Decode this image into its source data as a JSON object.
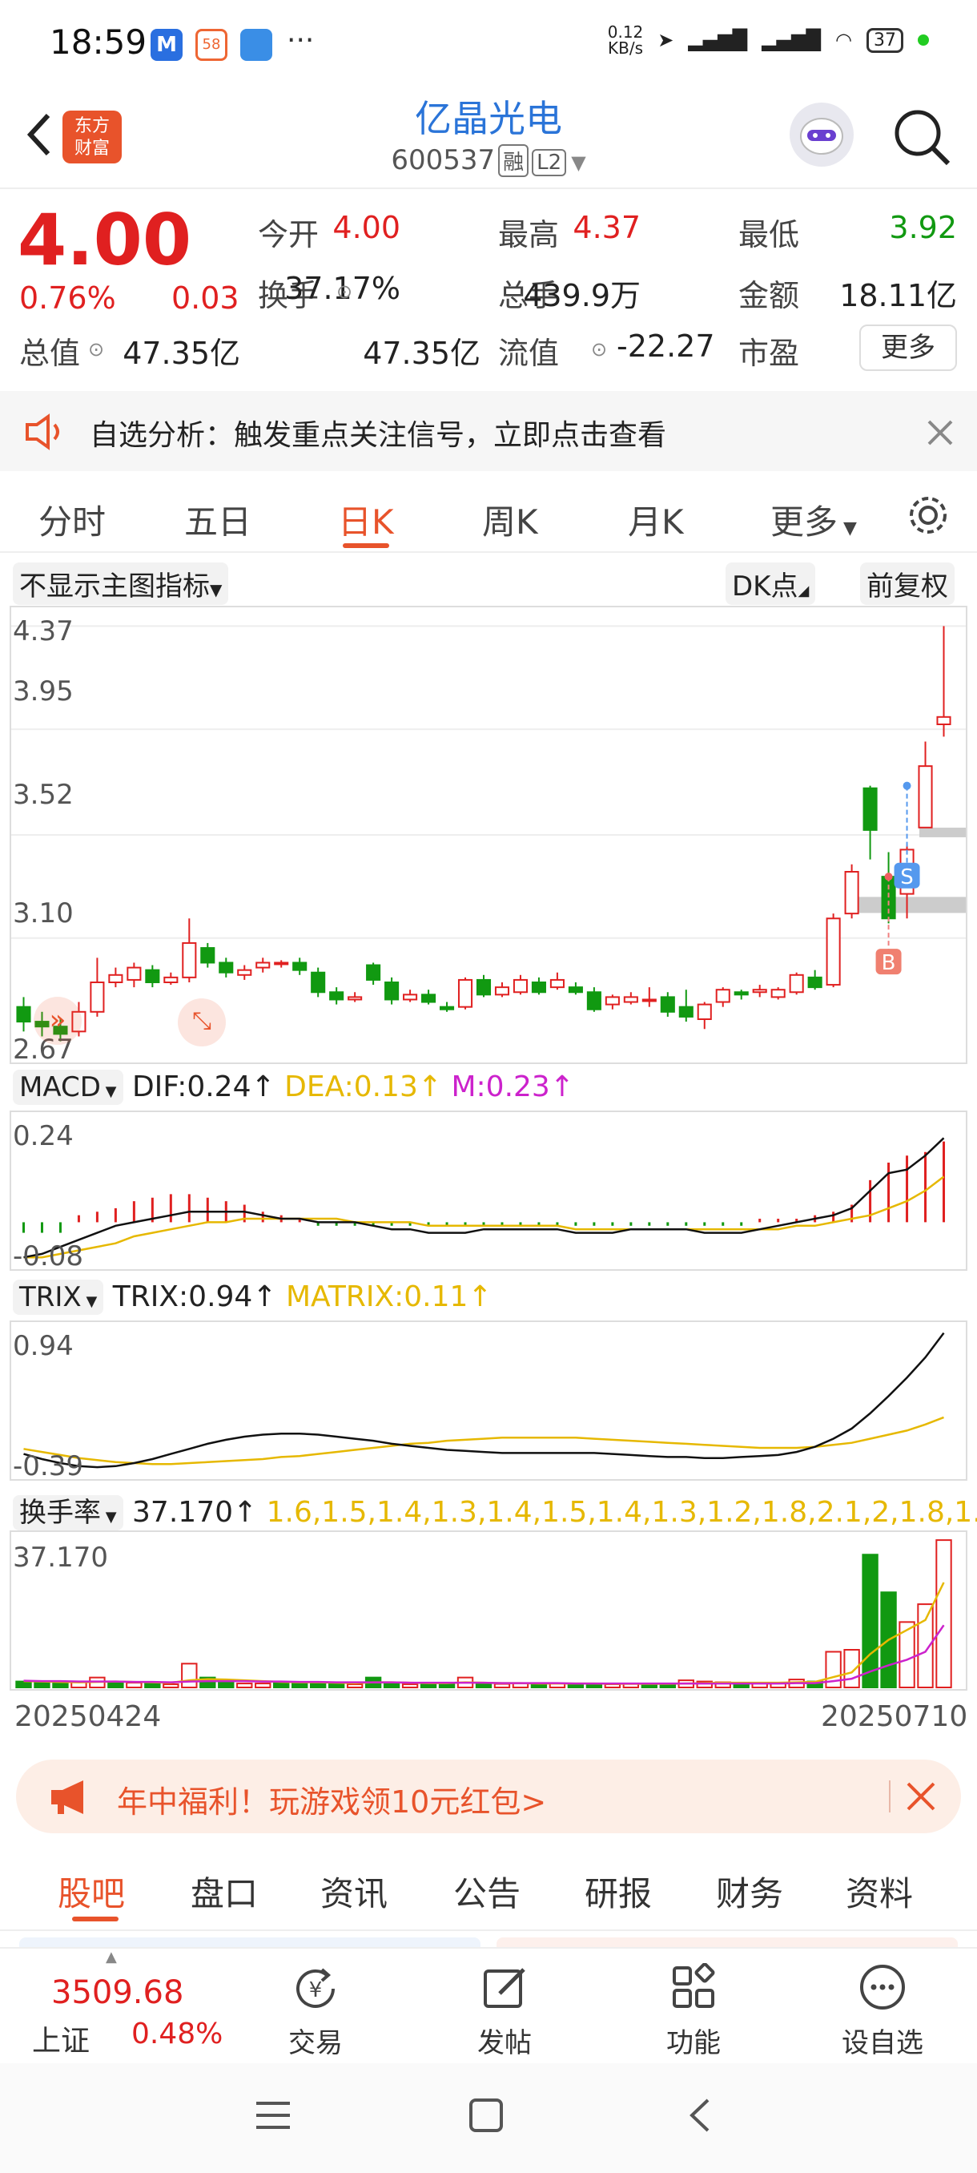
{
  "status_bar": {
    "time": "18:59",
    "net_speed": "0.12\nKB/s",
    "battery": "37"
  },
  "header": {
    "title": "亿晶光电",
    "code": "600537",
    "tag1": "融",
    "tag2": "L2",
    "logo": "东方\n财富"
  },
  "quote": {
    "price": "4.00",
    "change_pct": "0.76%",
    "change": "0.03",
    "fields": [
      {
        "label": "今开",
        "value": "4.00",
        "color": "red"
      },
      {
        "label": "最高",
        "value": "4.37",
        "color": "red"
      },
      {
        "label": "最低",
        "value": "3.92",
        "color": "green"
      },
      {
        "label": "换手",
        "value": "37.17%",
        "color": "black"
      },
      {
        "label": "总手",
        "value": "439.9万",
        "color": "black"
      },
      {
        "label": "金额",
        "value": "18.11亿",
        "color": "black"
      },
      {
        "label": "总值",
        "value": "47.35亿",
        "color": "black"
      },
      {
        "label": "流值",
        "value": "47.35亿",
        "color": "black"
      },
      {
        "label": "市盈",
        "value": "-22.27",
        "color": "black"
      }
    ],
    "more": "更多"
  },
  "notice": {
    "text": "自选分析：触发重点关注信号，立即点击查看"
  },
  "tabs": [
    "分时",
    "五日",
    "日K",
    "周K",
    "月K",
    "更多"
  ],
  "active_tab": "日K",
  "chart_toolbar": {
    "indicator": "不显示主图指标",
    "dk": "DK点",
    "adjust": "前复权"
  },
  "chart_data": [
    {
      "type": "candlestick",
      "y_ticks": [
        "4.37",
        "3.95",
        "3.52",
        "3.10",
        "2.67"
      ],
      "ylim": [
        2.62,
        4.42
      ],
      "markers": [
        "B",
        "S"
      ],
      "candles": [
        [
          2.82,
          2.76,
          2.86,
          2.72
        ],
        [
          2.76,
          2.74,
          2.8,
          2.7
        ],
        [
          2.74,
          2.71,
          2.77,
          2.68
        ],
        [
          2.72,
          2.8,
          2.84,
          2.7
        ],
        [
          2.8,
          2.92,
          3.02,
          2.78
        ],
        [
          2.92,
          2.95,
          2.98,
          2.9
        ],
        [
          2.93,
          2.98,
          3.0,
          2.9
        ],
        [
          2.97,
          2.92,
          2.99,
          2.9
        ],
        [
          2.92,
          2.94,
          2.96,
          2.91
        ],
        [
          2.94,
          3.08,
          3.18,
          2.92
        ],
        [
          3.06,
          3.0,
          3.08,
          2.98
        ],
        [
          3.0,
          2.96,
          3.02,
          2.94
        ],
        [
          2.95,
          2.97,
          2.99,
          2.93
        ],
        [
          2.98,
          3.0,
          3.02,
          2.96
        ],
        [
          3.0,
          3.0,
          3.01,
          2.98
        ],
        [
          3.0,
          2.97,
          3.02,
          2.95
        ],
        [
          2.96,
          2.88,
          2.98,
          2.86
        ],
        [
          2.88,
          2.85,
          2.9,
          2.83
        ],
        [
          2.85,
          2.86,
          2.88,
          2.84
        ],
        [
          2.99,
          2.93,
          3.0,
          2.91
        ],
        [
          2.92,
          2.85,
          2.94,
          2.83
        ],
        [
          2.85,
          2.87,
          2.89,
          2.84
        ],
        [
          2.87,
          2.84,
          2.89,
          2.83
        ],
        [
          2.82,
          2.81,
          2.84,
          2.8
        ],
        [
          2.82,
          2.93,
          2.94,
          2.81
        ],
        [
          2.93,
          2.87,
          2.95,
          2.86
        ],
        [
          2.87,
          2.9,
          2.92,
          2.86
        ],
        [
          2.88,
          2.93,
          2.95,
          2.87
        ],
        [
          2.92,
          2.88,
          2.94,
          2.87
        ],
        [
          2.9,
          2.93,
          2.96,
          2.89
        ],
        [
          2.9,
          2.88,
          2.92,
          2.87
        ],
        [
          2.88,
          2.81,
          2.9,
          2.8
        ],
        [
          2.83,
          2.86,
          2.87,
          2.81
        ],
        [
          2.84,
          2.86,
          2.88,
          2.83
        ],
        [
          2.85,
          2.85,
          2.9,
          2.82
        ],
        [
          2.86,
          2.8,
          2.88,
          2.78
        ],
        [
          2.82,
          2.78,
          2.89,
          2.76
        ],
        [
          2.77,
          2.83,
          2.84,
          2.73
        ],
        [
          2.84,
          2.89,
          2.9,
          2.82
        ],
        [
          2.88,
          2.87,
          2.89,
          2.85
        ],
        [
          2.88,
          2.89,
          2.91,
          2.86
        ],
        [
          2.86,
          2.89,
          2.9,
          2.85
        ],
        [
          2.88,
          2.95,
          2.96,
          2.87
        ],
        [
          2.94,
          2.9,
          2.97,
          2.89
        ],
        [
          2.91,
          3.18,
          3.2,
          2.9
        ],
        [
          3.2,
          3.37,
          3.4,
          3.18
        ],
        [
          3.71,
          3.54,
          3.72,
          3.42
        ],
        [
          3.35,
          3.18,
          3.45,
          3.16
        ],
        [
          3.28,
          3.46,
          3.48,
          3.18
        ],
        [
          3.55,
          3.8,
          3.9,
          3.55
        ],
        [
          3.97,
          4.0,
          4.37,
          3.92
        ]
      ]
    },
    {
      "type": "macd",
      "label": "MACD",
      "dif": "DIF:0.24",
      "dea": "DEA:0.13",
      "m": "M:0.23",
      "y_ticks": [
        "0.24",
        "-0.08"
      ],
      "ylim": [
        -0.12,
        0.3
      ],
      "dif_values": [
        -0.1,
        -0.09,
        -0.07,
        -0.05,
        -0.03,
        -0.01,
        0.0,
        0.01,
        0.02,
        0.03,
        0.03,
        0.03,
        0.03,
        0.02,
        0.01,
        0.01,
        0.0,
        0.0,
        0.0,
        -0.01,
        -0.02,
        -0.02,
        -0.03,
        -0.03,
        -0.03,
        -0.02,
        -0.02,
        -0.02,
        -0.02,
        -0.02,
        -0.03,
        -0.03,
        -0.03,
        -0.02,
        -0.02,
        -0.02,
        -0.02,
        -0.03,
        -0.03,
        -0.03,
        -0.02,
        -0.01,
        0.0,
        0.01,
        0.02,
        0.04,
        0.09,
        0.14,
        0.15,
        0.19,
        0.24
      ],
      "dea_values": [
        -0.1,
        -0.1,
        -0.09,
        -0.08,
        -0.07,
        -0.06,
        -0.04,
        -0.03,
        -0.02,
        -0.01,
        0.0,
        0.0,
        0.01,
        0.01,
        0.01,
        0.01,
        0.01,
        0.01,
        0.0,
        0.0,
        0.0,
        0.0,
        -0.01,
        -0.01,
        -0.01,
        -0.01,
        -0.01,
        -0.01,
        -0.01,
        -0.01,
        -0.02,
        -0.02,
        -0.02,
        -0.02,
        -0.02,
        -0.02,
        -0.02,
        -0.02,
        -0.02,
        -0.02,
        -0.02,
        -0.02,
        -0.01,
        -0.01,
        0.0,
        0.01,
        0.02,
        0.04,
        0.06,
        0.09,
        0.13
      ],
      "m_values": [
        -0.03,
        -0.03,
        -0.03,
        0.02,
        0.03,
        0.04,
        0.06,
        0.07,
        0.08,
        0.08,
        0.07,
        0.06,
        0.05,
        0.03,
        0.02,
        0.01,
        -0.01,
        -0.01,
        -0.01,
        -0.01,
        -0.01,
        -0.01,
        -0.01,
        -0.01,
        -0.01,
        -0.01,
        -0.01,
        -0.01,
        -0.01,
        -0.01,
        -0.01,
        -0.01,
        -0.01,
        -0.01,
        -0.01,
        -0.01,
        -0.01,
        -0.01,
        -0.01,
        -0.01,
        0.01,
        0.01,
        0.01,
        0.02,
        0.03,
        0.05,
        0.12,
        0.17,
        0.19,
        0.2,
        0.23
      ]
    },
    {
      "type": "line",
      "label": "TRIX",
      "trix": "TRIX:0.94",
      "matrix": "MATRIX:0.11",
      "y_ticks": [
        "0.94",
        "-0.39"
      ],
      "ylim": [
        -0.45,
        1.0
      ],
      "trix_values": [
        -0.25,
        -0.3,
        -0.34,
        -0.37,
        -0.38,
        -0.37,
        -0.34,
        -0.3,
        -0.25,
        -0.2,
        -0.15,
        -0.11,
        -0.08,
        -0.06,
        -0.05,
        -0.05,
        -0.06,
        -0.08,
        -0.1,
        -0.12,
        -0.15,
        -0.17,
        -0.19,
        -0.21,
        -0.22,
        -0.23,
        -0.24,
        -0.24,
        -0.24,
        -0.24,
        -0.24,
        -0.24,
        -0.25,
        -0.26,
        -0.27,
        -0.28,
        -0.28,
        -0.29,
        -0.29,
        -0.28,
        -0.27,
        -0.26,
        -0.23,
        -0.18,
        -0.1,
        0.0,
        0.15,
        0.32,
        0.5,
        0.7,
        0.94
      ],
      "matrix_values": [
        -0.2,
        -0.23,
        -0.26,
        -0.29,
        -0.31,
        -0.33,
        -0.34,
        -0.35,
        -0.35,
        -0.34,
        -0.33,
        -0.32,
        -0.31,
        -0.3,
        -0.28,
        -0.27,
        -0.25,
        -0.23,
        -0.21,
        -0.19,
        -0.17,
        -0.15,
        -0.14,
        -0.12,
        -0.11,
        -0.1,
        -0.09,
        -0.09,
        -0.09,
        -0.09,
        -0.09,
        -0.1,
        -0.11,
        -0.12,
        -0.13,
        -0.14,
        -0.15,
        -0.16,
        -0.17,
        -0.18,
        -0.19,
        -0.19,
        -0.19,
        -0.18,
        -0.16,
        -0.14,
        -0.1,
        -0.06,
        -0.02,
        0.04,
        0.11
      ]
    },
    {
      "type": "bar",
      "label": "换手率",
      "value": "37.170",
      "ma1": [
        1.6,
        1.5,
        1.4,
        1.3,
        1.4,
        1.5,
        1.4,
        1.3,
        1.2,
        1.8,
        2.1,
        2.0,
        1.8,
        1.6,
        1.4,
        1.3,
        1.3,
        1.2,
        1.1,
        1.3,
        1.3,
        1.2,
        1.1,
        1.1,
        1.3,
        1.2,
        1.1,
        1.1,
        1.0,
        1.0,
        1.0,
        1.0,
        0.9,
        0.9,
        0.9,
        0.9,
        1.0,
        1.1,
        1.2,
        1.2,
        1.2,
        1.2,
        1.3,
        1.4,
        2.6,
        3.8,
        8.4,
        12.0,
        14.5,
        17.0,
        26.48
      ],
      "ma2": [
        1.7,
        1.6,
        1.6,
        1.5,
        1.5,
        1.5,
        1.4,
        1.4,
        1.3,
        1.5,
        1.6,
        1.6,
        1.6,
        1.5,
        1.5,
        1.4,
        1.4,
        1.3,
        1.3,
        1.3,
        1.3,
        1.2,
        1.2,
        1.2,
        1.2,
        1.2,
        1.1,
        1.1,
        1.1,
        1.1,
        1.0,
        1.0,
        1.0,
        1.0,
        1.0,
        1.0,
        1.0,
        1.0,
        1.0,
        1.0,
        1.0,
        1.0,
        1.1,
        1.1,
        1.6,
        2.2,
        4.0,
        5.6,
        7.0,
        9.0,
        15.71
      ],
      "y_ticks": [
        "37.170"
      ],
      "ylim": [
        0,
        38
      ],
      "x_start": "20250424",
      "x_end": "20250710",
      "values": [
        1.5,
        1.2,
        1.0,
        1.3,
        2.5,
        1.5,
        1.2,
        1.0,
        0.8,
        6.0,
        2.5,
        1.2,
        1.0,
        1.0,
        1.1,
        1.0,
        1.1,
        0.9,
        0.8,
        2.5,
        1.2,
        0.8,
        0.9,
        0.8,
        2.5,
        1.0,
        0.9,
        1.0,
        0.9,
        1.0,
        0.9,
        0.8,
        0.8,
        0.9,
        1.0,
        0.8,
        1.8,
        1.5,
        1.3,
        1.0,
        1.1,
        1.0,
        2.0,
        1.5,
        9.0,
        9.5,
        33.5,
        24.0,
        16.5,
        21.0,
        37.17
      ],
      "up": [
        0,
        0,
        0,
        1,
        1,
        0,
        1,
        0,
        1,
        1,
        0,
        0,
        1,
        1,
        0,
        0,
        0,
        0,
        1,
        0,
        0,
        1,
        0,
        0,
        1,
        0,
        1,
        1,
        0,
        1,
        0,
        0,
        1,
        1,
        0,
        0,
        1,
        1,
        1,
        0,
        1,
        1,
        1,
        0,
        1,
        1,
        0,
        0,
        1,
        1,
        1
      ]
    }
  ],
  "promo": {
    "text": "年中福利！玩游戏领10元红包>"
  },
  "bottom_tabs": [
    "股吧",
    "盘口",
    "资讯",
    "公告",
    "研报",
    "财务",
    "资料"
  ],
  "bottom_bar": {
    "index_value": "3509.68",
    "index_name": "上证",
    "index_change": "0.48%",
    "trade": "交易",
    "post": "发帖",
    "function": "功能",
    "watch": "设自选"
  },
  "colors": {
    "up": "#e02020",
    "down": "#119911",
    "accent": "#e8532b",
    "link": "#2a74d8",
    "dea": "#e6b800",
    "m": "#cc22cc"
  }
}
